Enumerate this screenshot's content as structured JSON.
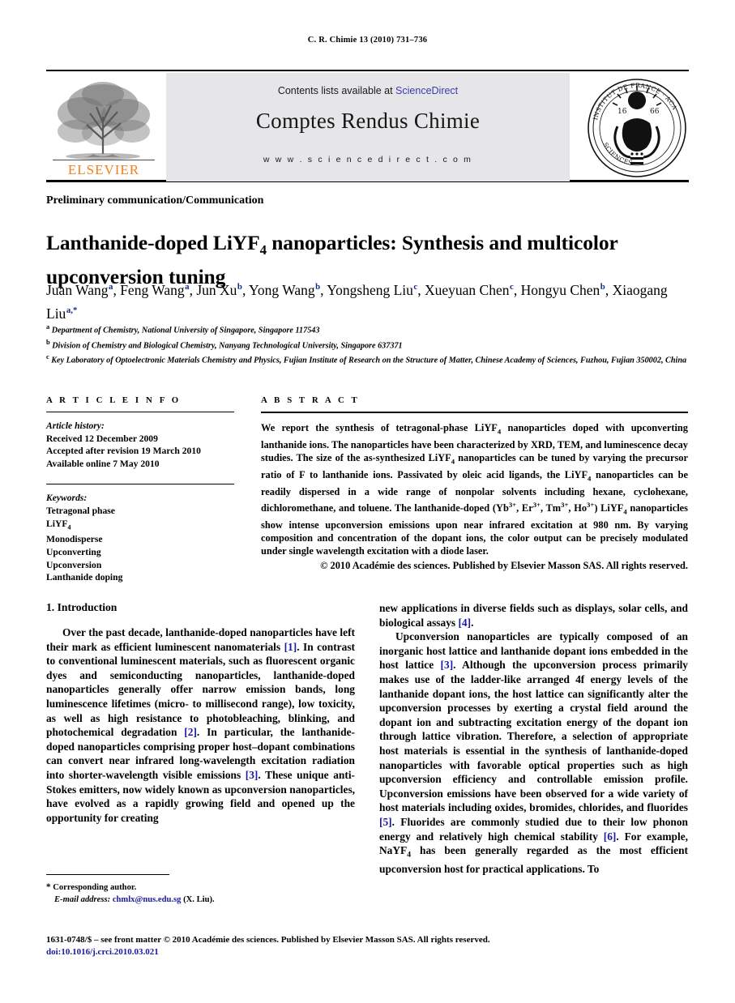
{
  "running_head": "C. R. Chimie 13 (2010) 731–736",
  "masthead": {
    "contents_prefix": "Contents lists available at ",
    "sciencedirect_link": "ScienceDirect",
    "journal_title": "Comptes Rendus Chimie",
    "url": "w w w . s c i e n c e d i r e c t . c o m",
    "publisher_wordmark": "ELSEVIER",
    "publisher_logo_alt": "elsevier-tree-logo",
    "seal_alt": "academie-des-sciences-seal",
    "banner_bg": "#e6e6e8",
    "link_color": "#3b3bb0",
    "wordmark_color": "#f08020"
  },
  "section_label": "Preliminary communication/Communication",
  "article_title_part1": "Lanthanide-doped LiYF",
  "article_title_sub": "4",
  "article_title_part2": " nanoparticles: Synthesis and multicolor upconversion tuning",
  "authors": [
    {
      "name": "Juan Wang",
      "marks": "a",
      "sep": ", "
    },
    {
      "name": "Feng Wang",
      "marks": "a",
      "sep": ", "
    },
    {
      "name": "Jun Xu",
      "marks": "b",
      "sep": ", "
    },
    {
      "name": "Yong Wang",
      "marks": "b",
      "sep": ", "
    },
    {
      "name": "Yongsheng Liu",
      "marks": "c",
      "sep": ", "
    },
    {
      "name": "Xueyuan Chen",
      "marks": "c",
      "sep": ", "
    },
    {
      "name": "Hongyu Chen",
      "marks": "b",
      "sep": ", "
    },
    {
      "name": "Xiaogang Liu",
      "marks": "a,*",
      "sep": ""
    }
  ],
  "affiliations": [
    {
      "mark": "a",
      "text": "Department of Chemistry, National University of Singapore, Singapore 117543"
    },
    {
      "mark": "b",
      "text": "Division of Chemistry and Biological Chemistry, Nanyang Technological University, Singapore 637371"
    },
    {
      "mark": "c",
      "text": "Key Laboratory of Optoelectronic Materials Chemistry and Physics, Fujian Institute of Research on the Structure of Matter, Chinese Academy of Sciences, Fuzhou, Fujian 350002, China"
    }
  ],
  "article_info": {
    "heading": "A R T I C L E  I N F O",
    "history_label": "Article history:",
    "history": [
      "Received 12 December 2009",
      "Accepted after revision 19 March 2010",
      "Available online 7 May 2010"
    ],
    "keywords_label": "Keywords:",
    "keywords": [
      "Tetragonal phase",
      "LiYF4",
      "Monodisperse",
      "Upconverting",
      "Upconversion",
      "Lanthanide doping"
    ]
  },
  "abstract": {
    "heading": "A B S T R A C T",
    "text_p1": "We report the synthesis of tetragonal-phase LiYF",
    "text_p2": " nanoparticles doped with upconverting lanthanide ions. The nanoparticles have been characterized by XRD, TEM, and luminescence decay studies. The size of the as-synthesized LiYF",
    "text_p3": " nanoparticles can be tuned by varying the precursor ratio of F to lanthanide ions. Passivated by oleic acid ligands, the LiYF",
    "text_p4": " nanoparticles can be readily dispersed in a wide range of nonpolar solvents including hexane, cyclohexane, dichloromethane, and toluene. The lanthanide-doped (Yb",
    "text_p5": ", Er",
    "text_p6": ", Tm",
    "text_p7": ", Ho",
    "text_p8": ") LiYF",
    "text_p9": " nanoparticles show intense upconversion emissions upon near infrared excitation at 980 nm. By varying composition and concentration of the dopant ions, the color output can be precisely modulated under single wavelength excitation with a diode laser.",
    "sub4": "4",
    "sup3plus": "3+",
    "copyright": "© 2010 Académie des sciences. Published by Elsevier Masson SAS. All rights reserved."
  },
  "body": {
    "intro_heading": "1. Introduction",
    "left_para1_a": "Over the past decade, lanthanide-doped nanoparticles have left their mark as efficient luminescent nanomaterials ",
    "left_ref1": "[1]",
    "left_para1_b": ". In contrast to conventional luminescent materials, such as fluorescent organic dyes and semiconducting nanoparticles, lanthanide-doped nanoparticles generally offer narrow emission bands, long luminescence lifetimes (micro- to millisecond range), low toxicity, as well as high resistance to photobleaching, blinking, and photochemical degradation ",
    "left_ref2": "[2]",
    "left_para1_c": ". In particular, the lanthanide-doped nanoparticles comprising proper host–dopant combinations can convert near infrared long-wavelength excitation radiation into shorter-wavelength visible emissions ",
    "left_ref3": "[3]",
    "left_para1_d": ". These unique anti-Stokes emitters, now widely known as upconversion nanoparticles, have evolved as a rapidly growing field and opened up the opportunity for creating",
    "right_cont_a": "new applications in diverse fields such as displays, solar cells, and biological assays ",
    "right_ref4": "[4]",
    "right_cont_b": ".",
    "right_para2_a": "Upconversion nanoparticles are typically composed of an inorganic host lattice and lanthanide dopant ions embedded in the host lattice ",
    "right_ref3": "[3]",
    "right_para2_b": ". Although the upconversion process primarily makes use of the ladder-like arranged 4f energy levels of the lanthanide dopant ions, the host lattice can significantly alter the upconversion processes by exerting a crystal field around the dopant ion and subtracting excitation energy of the dopant ion through lattice vibration. Therefore, a selection of appropriate host materials is essential in the synthesis of lanthanide-doped nanoparticles with favorable optical properties such as high upconversion efficiency and controllable emission profile. Upconversion emissions have been observed for a wide variety of host materials including oxides, bromides, chlorides, and fluorides ",
    "right_ref5": "[5]",
    "right_para2_c": ". Fluorides are commonly studied due to their low phonon energy and relatively high chemical stability ",
    "right_ref6": "[6]",
    "right_para2_d": ". For example, NaYF",
    "right_sub4": "4",
    "right_para2_e": " has been generally regarded as the most efficient upconversion host for practical applications. To"
  },
  "footnote": {
    "star": "*",
    "corresponding": "Corresponding author.",
    "email_label": "E-mail address:",
    "email": "chmlx@nus.edu.sg",
    "email_owner": "(X. Liu)."
  },
  "footer": {
    "copyright_line": "1631-0748/$ – see front matter © 2010 Académie des sciences. Published by Elsevier Masson SAS. All rights reserved.",
    "doi": "doi:10.1016/j.crci.2010.03.021"
  }
}
